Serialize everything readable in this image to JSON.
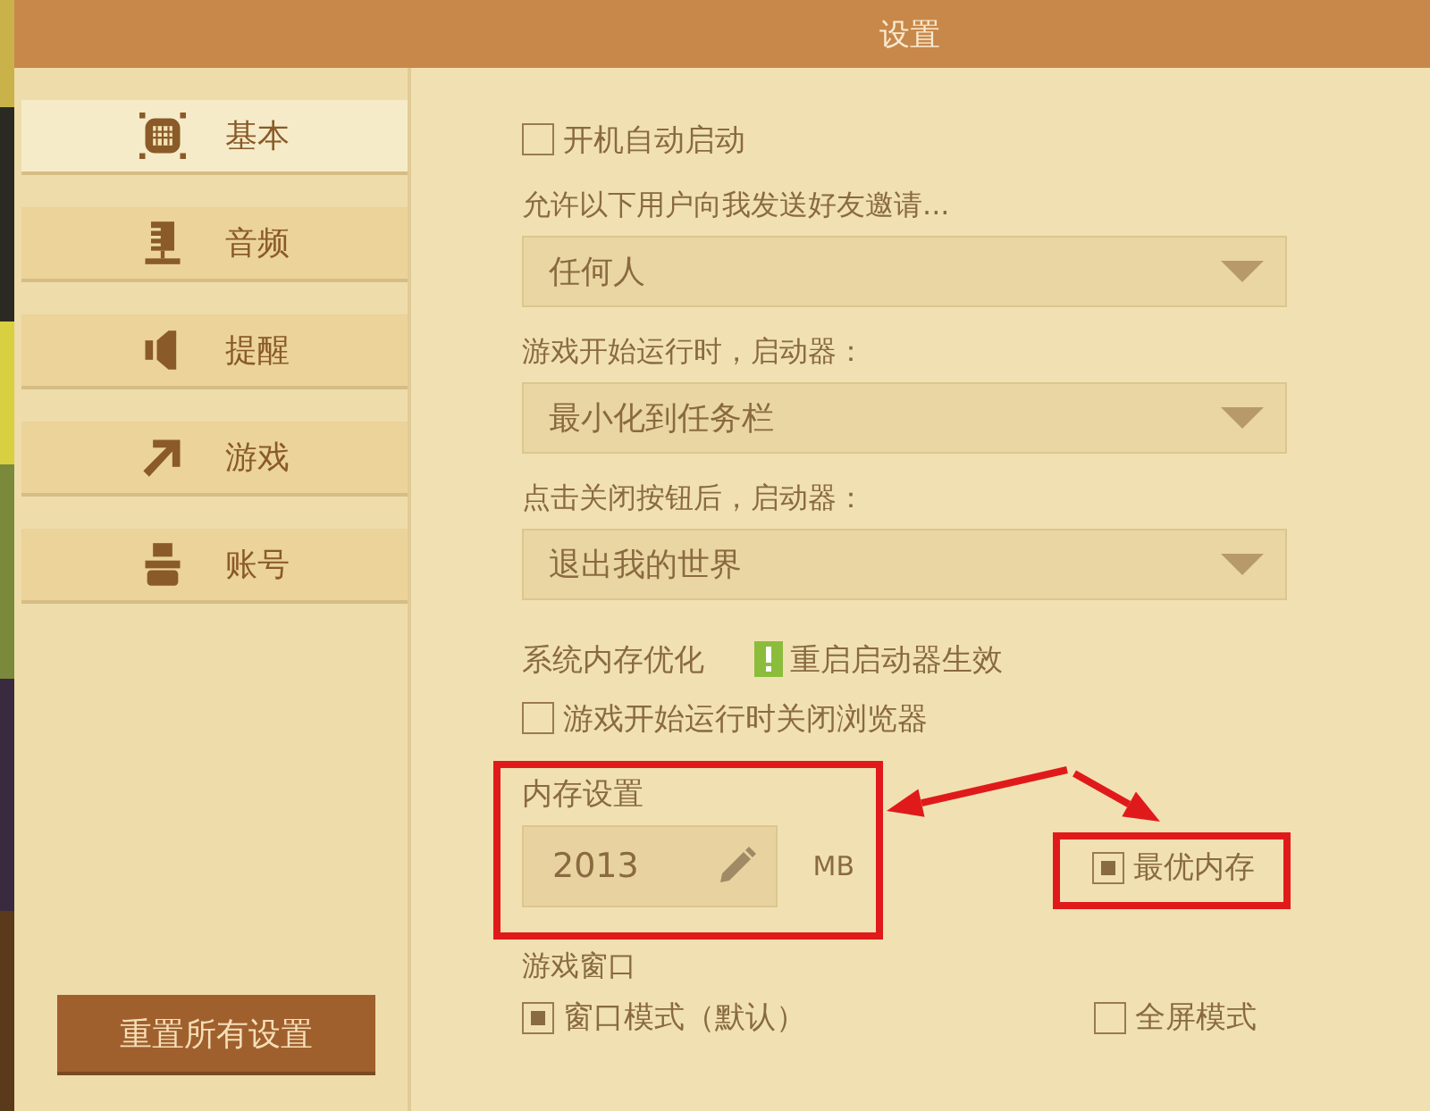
{
  "window": {
    "title": "设置"
  },
  "sidebar": {
    "items": [
      {
        "label": "基本",
        "selected": true
      },
      {
        "label": "音频",
        "selected": false
      },
      {
        "label": "提醒",
        "selected": false
      },
      {
        "label": "游戏",
        "selected": false
      },
      {
        "label": "账号",
        "selected": false
      }
    ],
    "reset_button": "重置所有设置"
  },
  "settings": [
    {
      "kind": "checkbox",
      "label": "开机自动启动",
      "checked": false
    },
    {
      "kind": "dropdown",
      "label": "允许以下用户向我发送好友邀请...",
      "value": "任何人"
    },
    {
      "kind": "dropdown",
      "label": "游戏开始运行时，启动器：",
      "value": "最小化到任务栏"
    },
    {
      "kind": "dropdown",
      "label": "点击关闭按钮后，启动器：",
      "value": "退出我的世界"
    },
    {
      "kind": "notice",
      "label": "系统内存优化",
      "note": "重启启动器生效"
    },
    {
      "kind": "checkbox",
      "label": "游戏开始运行时关闭浏览器",
      "checked": false
    },
    {
      "kind": "memory",
      "label": "内存设置",
      "value": "2013",
      "unit": "MB",
      "highlighted": true,
      "optimal": {
        "label": "最优内存",
        "checked": true,
        "highlighted": true
      }
    },
    {
      "kind": "mode",
      "label": "游戏窗口",
      "options": [
        {
          "label": "窗口模式（默认）",
          "selected": true
        },
        {
          "label": "全屏模式",
          "selected": false
        }
      ]
    }
  ]
}
